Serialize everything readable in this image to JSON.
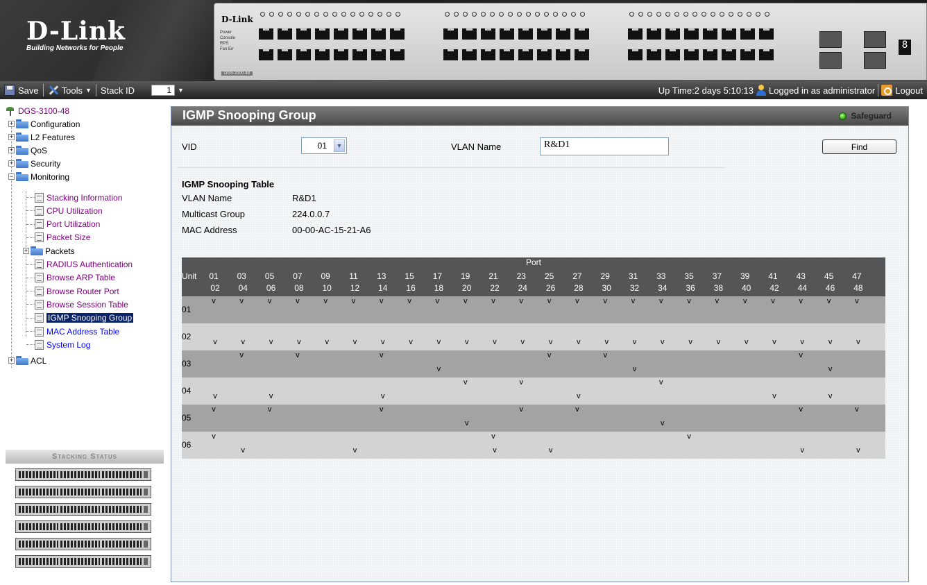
{
  "header": {
    "brand": "D-Link",
    "tagline": "Building Networks for People",
    "panel_brand": "D-Link",
    "panel_leds": [
      "Power",
      "Console",
      "RPS",
      "Fan Err"
    ],
    "panel_model": "DGS-3100-48",
    "stack_display": "8"
  },
  "toolbar": {
    "save_label": "Save",
    "tools_label": "Tools",
    "stack_id_label": "Stack ID",
    "stack_id_value": "1",
    "uptime": "Up Time:2 days 5:10:13",
    "logged_in": "Logged in as administrator",
    "logout_label": "Logout"
  },
  "tree": {
    "root": "DGS-3100-48",
    "folders": [
      "Configuration",
      "L2 Features",
      "QoS",
      "Security",
      "Monitoring"
    ],
    "monitoring_items": [
      "Stacking Information",
      "CPU Utilization",
      "Port Utilization",
      "Packet Size",
      "Packets",
      "RADIUS Authentication",
      "Browse ARP Table",
      "Browse Router Port",
      "Browse Session Table",
      "IGMP Snooping Group",
      "MAC Address Table",
      "System Log"
    ],
    "acl": "ACL"
  },
  "stacking_status": {
    "title": "Stacking Status",
    "units": 6
  },
  "main": {
    "title": "IGMP Snooping Group",
    "safeguard": "Safeguard",
    "vid_label": "VID",
    "vid_value": "01",
    "vlan_name_label": "VLAN Name",
    "vlan_name_value": "R&D1",
    "find_label": "Find",
    "table_title": "IGMP Snooping Table",
    "info": [
      {
        "label": "VLAN Name",
        "value": "R&D1"
      },
      {
        "label": "Multicast Group",
        "value": "224.0.0.7"
      },
      {
        "label": "MAC Address",
        "value": "00-00-AC-15-21-A6"
      }
    ]
  },
  "port_table": {
    "port_header": "Port",
    "unit_header": "Unit",
    "odd_ports": [
      "01",
      "03",
      "05",
      "07",
      "09",
      "11",
      "13",
      "15",
      "17",
      "19",
      "21",
      "23",
      "25",
      "27",
      "29",
      "31",
      "33",
      "35",
      "37",
      "39",
      "41",
      "43",
      "45",
      "47"
    ],
    "even_ports": [
      "02",
      "04",
      "06",
      "08",
      "10",
      "12",
      "14",
      "16",
      "18",
      "20",
      "22",
      "24",
      "26",
      "28",
      "30",
      "32",
      "34",
      "36",
      "38",
      "40",
      "42",
      "44",
      "46",
      "48"
    ],
    "mark": "v",
    "rows": [
      {
        "unit": "01",
        "top": [
          1,
          1,
          1,
          1,
          1,
          1,
          1,
          1,
          1,
          1,
          1,
          1,
          1,
          1,
          1,
          1,
          1,
          1,
          1,
          1,
          1,
          1,
          1,
          1
        ],
        "bottom": [
          0,
          0,
          0,
          0,
          0,
          0,
          0,
          0,
          0,
          0,
          0,
          0,
          0,
          0,
          0,
          0,
          0,
          0,
          0,
          0,
          0,
          0,
          0,
          0
        ]
      },
      {
        "unit": "02",
        "top": [
          0,
          0,
          0,
          0,
          0,
          0,
          0,
          0,
          0,
          0,
          0,
          0,
          0,
          0,
          0,
          0,
          0,
          0,
          0,
          0,
          0,
          0,
          0,
          0
        ],
        "bottom": [
          1,
          1,
          1,
          1,
          1,
          1,
          1,
          1,
          1,
          1,
          1,
          1,
          1,
          1,
          1,
          1,
          1,
          1,
          1,
          1,
          1,
          1,
          1,
          1
        ]
      },
      {
        "unit": "03",
        "top": [
          0,
          1,
          0,
          1,
          0,
          0,
          1,
          0,
          0,
          0,
          0,
          0,
          1,
          0,
          1,
          0,
          0,
          0,
          0,
          0,
          0,
          1,
          0,
          0
        ],
        "bottom": [
          0,
          0,
          0,
          0,
          0,
          0,
          0,
          0,
          1,
          0,
          0,
          0,
          0,
          0,
          0,
          1,
          0,
          0,
          0,
          0,
          0,
          0,
          1,
          0
        ]
      },
      {
        "unit": "04",
        "top": [
          0,
          0,
          0,
          0,
          0,
          0,
          0,
          0,
          0,
          1,
          0,
          1,
          0,
          0,
          0,
          0,
          1,
          0,
          0,
          0,
          0,
          0,
          0,
          0
        ],
        "bottom": [
          1,
          0,
          1,
          0,
          0,
          0,
          1,
          0,
          0,
          0,
          0,
          0,
          0,
          1,
          0,
          0,
          0,
          0,
          0,
          0,
          1,
          0,
          1,
          0
        ]
      },
      {
        "unit": "05",
        "top": [
          1,
          0,
          1,
          0,
          0,
          0,
          1,
          0,
          0,
          0,
          0,
          1,
          0,
          1,
          0,
          0,
          0,
          0,
          0,
          0,
          0,
          1,
          0,
          1
        ],
        "bottom": [
          0,
          0,
          0,
          0,
          0,
          0,
          0,
          0,
          0,
          1,
          0,
          0,
          0,
          0,
          0,
          0,
          1,
          0,
          0,
          0,
          0,
          0,
          0,
          0
        ]
      },
      {
        "unit": "06",
        "top": [
          1,
          0,
          0,
          0,
          0,
          0,
          0,
          0,
          0,
          0,
          1,
          0,
          0,
          0,
          0,
          0,
          0,
          1,
          0,
          0,
          0,
          0,
          0,
          0
        ],
        "bottom": [
          0,
          1,
          0,
          0,
          0,
          1,
          0,
          0,
          0,
          0,
          1,
          0,
          1,
          0,
          0,
          0,
          0,
          0,
          0,
          0,
          0,
          1,
          0,
          1
        ]
      }
    ]
  }
}
